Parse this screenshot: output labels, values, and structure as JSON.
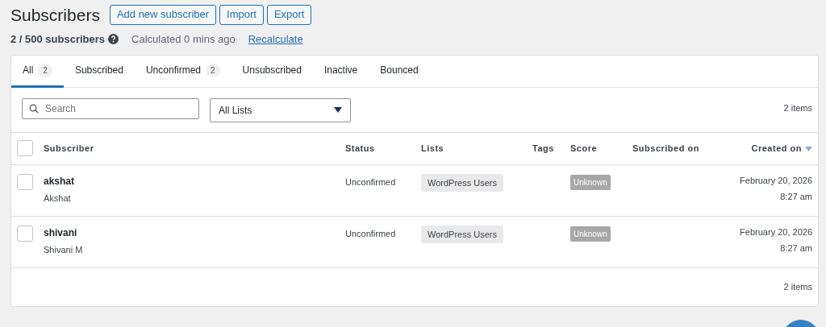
{
  "page_title": "Subscribers",
  "header_buttons": [
    "Add new subscriber",
    "Import",
    "Export"
  ],
  "summary": {
    "count": "2 / 500 subscribers",
    "calculated": "Calculated 0 mins ago",
    "recalculate_link": "Recalculate"
  },
  "tabs": [
    {
      "label": "All",
      "count": "2",
      "selected": true
    },
    {
      "label": "Subscribed",
      "selected": false
    },
    {
      "label": "Unconfirmed",
      "count": "2",
      "selected": false
    },
    {
      "label": "Unsubscribed",
      "selected": false
    },
    {
      "label": "Inactive",
      "selected": false
    },
    {
      "label": "Bounced",
      "selected": false
    }
  ],
  "search": {
    "placeholder": "Search"
  },
  "list_filter": {
    "value": "All Lists"
  },
  "items_count_top": "2 items",
  "table": {
    "select_all_checked": false,
    "columns": [
      {
        "label": "Subscriber",
        "sorted": false
      },
      {
        "label": "Status",
        "sorted": false
      },
      {
        "label": "Lists",
        "sorted": false
      },
      {
        "label": "Tags",
        "sorted": false
      },
      {
        "label": "Score",
        "sorted": false
      },
      {
        "label": "Subscribed on",
        "sorted": false
      },
      {
        "label": "Created on",
        "sorted": true
      }
    ],
    "rows": [
      {
        "checked": false,
        "username": "akshat",
        "name": "Akshat",
        "status": "Unconfirmed",
        "lists": [
          "WordPress Users"
        ],
        "score": "Unknown",
        "created_date": "February 20, 2026",
        "created_time": "8:27 am"
      },
      {
        "checked": false,
        "username": "shivani",
        "name": "Shivani M",
        "status": "Unconfirmed",
        "lists": [
          "WordPress Users"
        ],
        "score": "Unknown",
        "created_date": "February 20, 2026",
        "created_time": "8:27 am"
      }
    ]
  },
  "items_count_bottom": "2 items"
}
